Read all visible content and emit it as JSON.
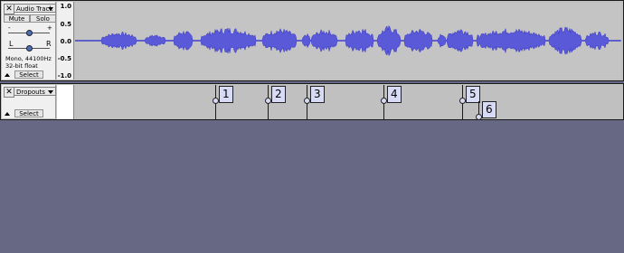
{
  "audio_track": {
    "name": "Audio Track",
    "mute_label": "Mute",
    "solo_label": "Solo",
    "gain_minus": "-",
    "gain_plus": "+",
    "pan_left": "L",
    "pan_right": "R",
    "format_line1": "Mono, 44100Hz",
    "format_line2": "32-bit float",
    "select_label": "Select",
    "close_glyph": "✕",
    "waveform_color": "#3232c8",
    "ruler_labels": [
      "1.0",
      "0.5",
      "0.0",
      "-0.5",
      "-1.0"
    ]
  },
  "label_track": {
    "name": "Dropouts",
    "select_label": "Select",
    "close_glyph": "✕",
    "labels": [
      "1",
      "2",
      "3",
      "4",
      "5",
      "6"
    ]
  }
}
